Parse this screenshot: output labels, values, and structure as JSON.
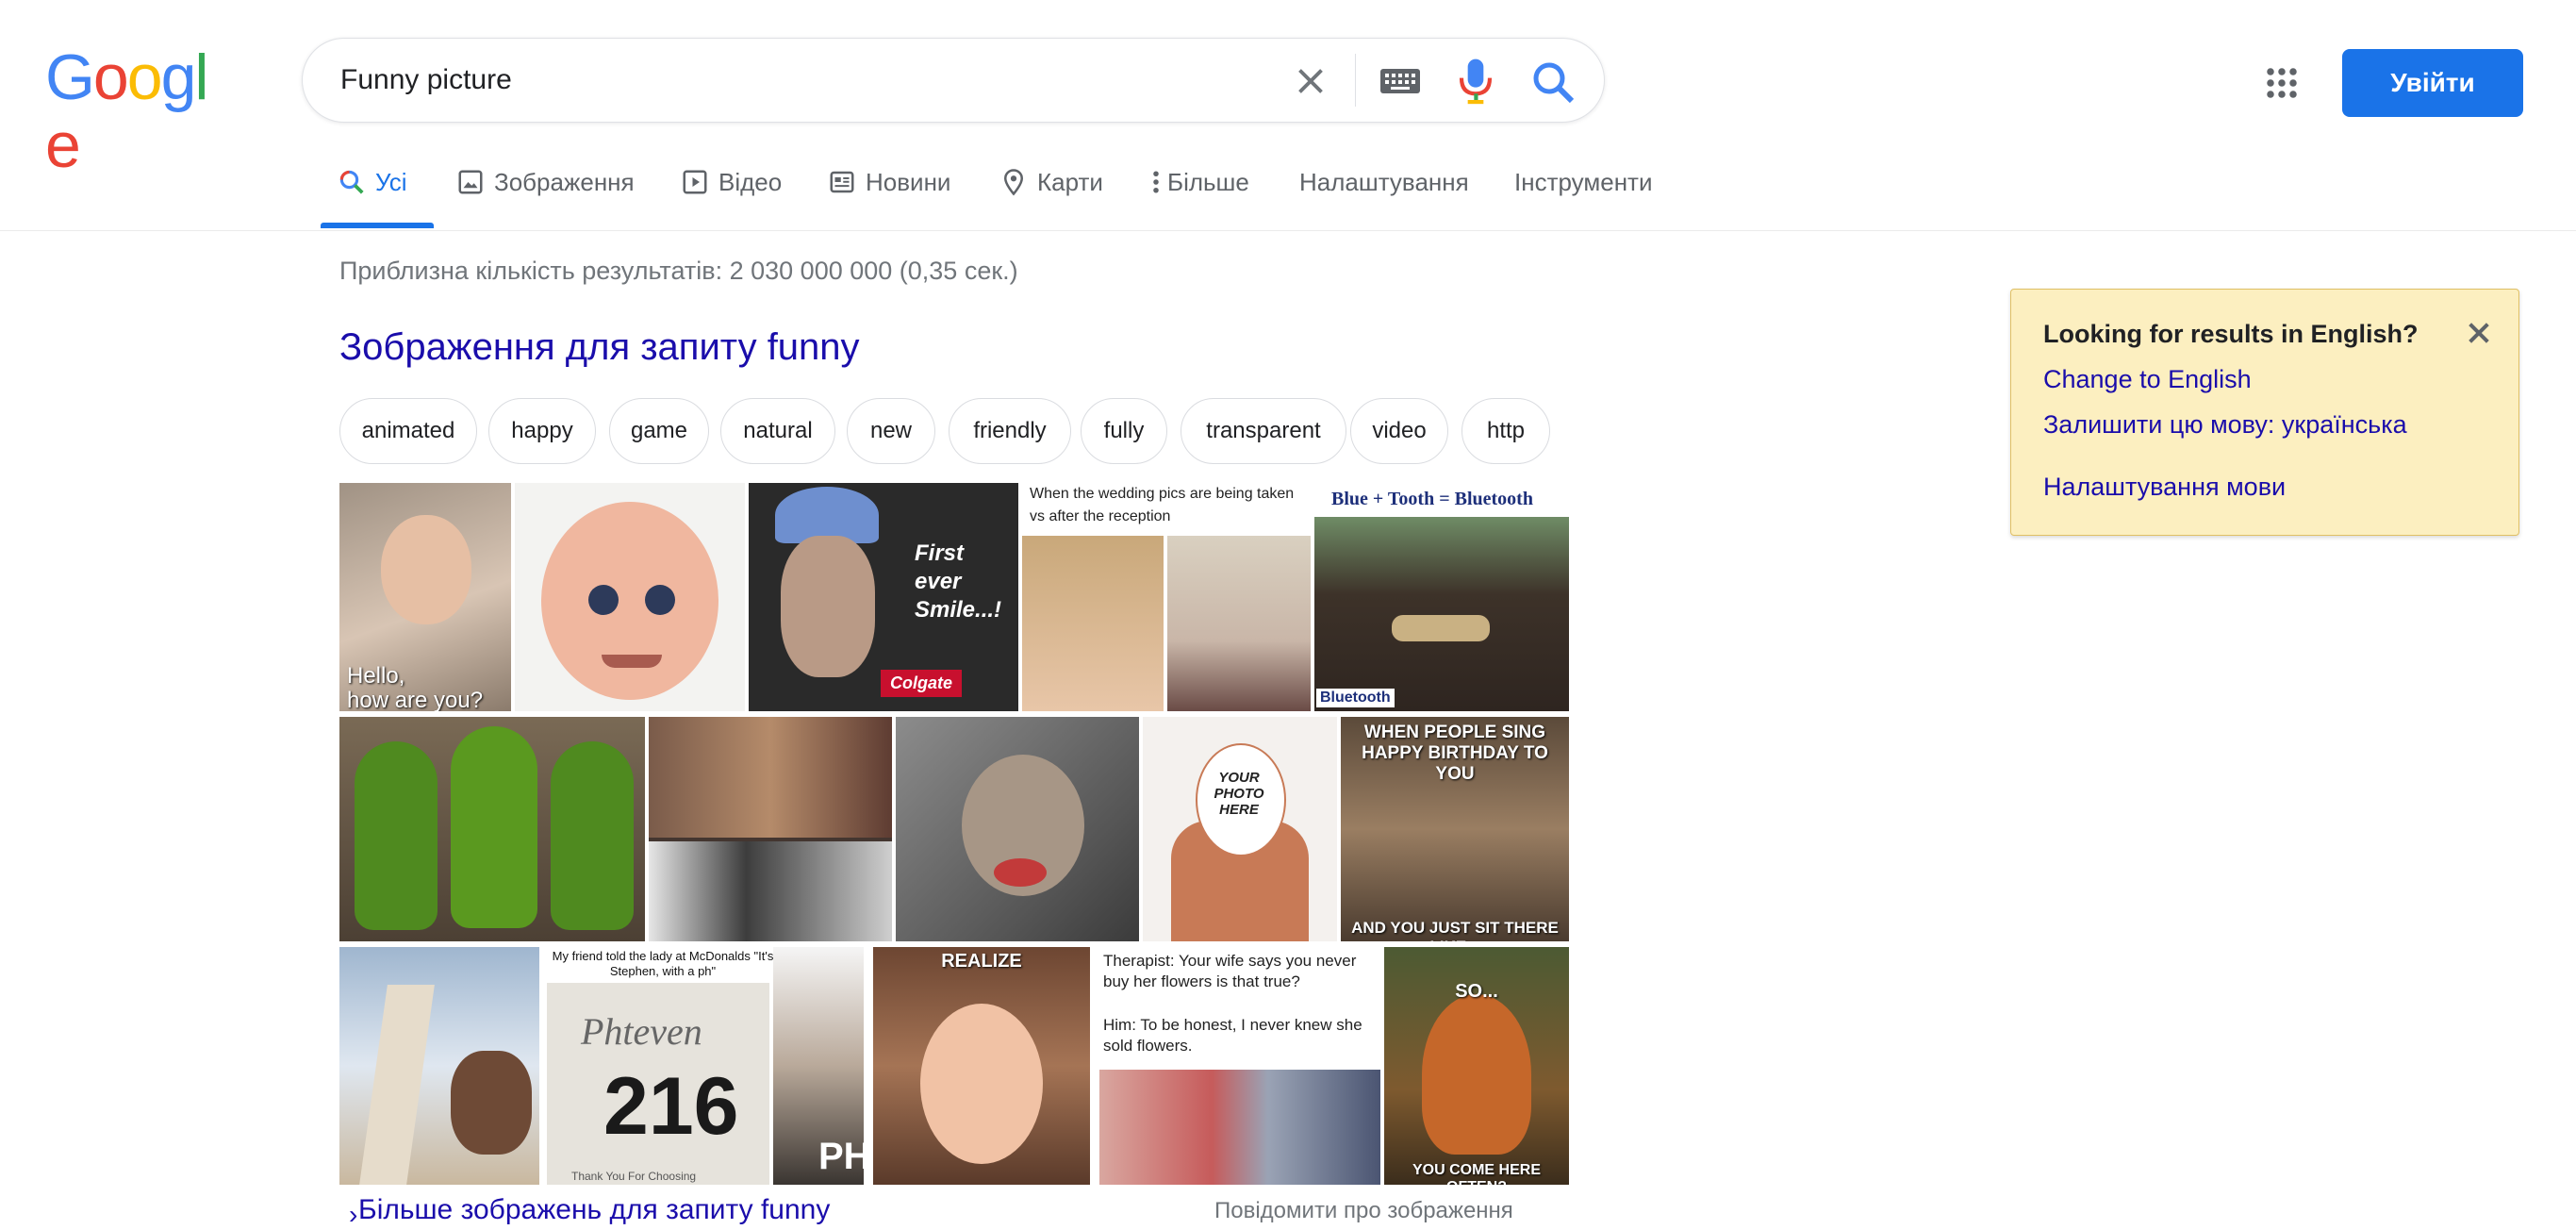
{
  "logo": {
    "letters": [
      "G",
      "o",
      "o",
      "g",
      "l",
      "e"
    ],
    "colors": [
      "#4285F4",
      "#EA4335",
      "#FBBC05",
      "#4285F4",
      "#34A853",
      "#EA4335"
    ]
  },
  "search": {
    "query": "Funny picture"
  },
  "header": {
    "signin_label": "Увійти"
  },
  "tabs": [
    {
      "label": "Усі",
      "icon": "search-icon",
      "active": true
    },
    {
      "label": "Зображення",
      "icon": "image-icon"
    },
    {
      "label": "Відео",
      "icon": "video-icon"
    },
    {
      "label": "Новини",
      "icon": "news-icon"
    },
    {
      "label": "Карти",
      "icon": "map-pin-icon"
    },
    {
      "label": "Більше",
      "icon": "more-vert-icon"
    },
    {
      "label": "Налаштування"
    },
    {
      "label": "Інструменти"
    }
  ],
  "results": {
    "stats": "Приблизна кількість результатів: 2 030 000 000 (0,35 сек.)",
    "images_heading": "Зображення для запиту funny",
    "chips": [
      "animated",
      "happy",
      "game",
      "natural",
      "new",
      "friendly",
      "fully",
      "transparent",
      "video",
      "http"
    ],
    "image_captions": {
      "baby": "Hello,\nhow are you?",
      "smile_line1": "First",
      "smile_line2": "ever",
      "smile_line3": "Smile...!",
      "colgate": "Colgate",
      "wedding": "When the wedding pics are being taken vs after the reception",
      "bluetooth_title": "Blue + Tooth = Bluetooth",
      "bluetooth_logo": "Bluetooth",
      "photo_here": "YOUR PHOTO HERE",
      "sing_top": "WHEN PEOPLE SING HAPPY BIRTHDAY TO YOU",
      "sing_bottom": "AND YOU JUST SIT THERE LIKE...",
      "mcd_top": "My friend told the lady at McDonalds \"It's Stephen, with a ph\"",
      "mcd_name": "Phteven",
      "mcd_num": "216",
      "mcd_foot": "Thank You For Choosing",
      "mcd_side": "PH",
      "realize": "REALIZE",
      "therapist": "Therapist: Your wife says you never buy her flowers is that true?",
      "therapist_reply": "Him: To be honest, I never knew she sold flowers.",
      "so": "SO...",
      "come_here": "YOU COME HERE OFTEN?"
    },
    "more_images": "Більше зображень для запиту funny",
    "report": "Повідомити про зображення"
  },
  "language_box": {
    "title": "Looking for results in English?",
    "change": "Change to English",
    "keep": "Залишити цю мову: українська",
    "settings": "Налаштування мови"
  }
}
